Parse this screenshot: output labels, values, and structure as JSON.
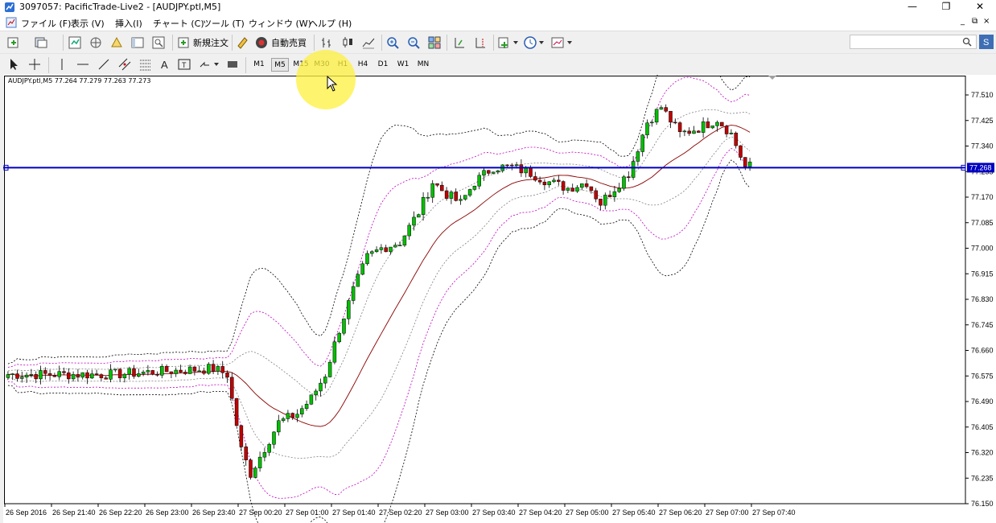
{
  "window": {
    "title": "3097057: PacificTrade-Live2 - [AUDJPY.ptl,M5]",
    "minimize_glyph": "—",
    "restore_glyph": "❐",
    "close_glyph": "✕"
  },
  "menu": {
    "items": [
      "ファイル (F)",
      "表示 (V)",
      "挿入(I)",
      "チャート (C)",
      "ツール (T)",
      "ウィンドウ (W)",
      "ヘルプ (H)"
    ],
    "mdi_glyphs": [
      "_",
      "⧉",
      "×"
    ]
  },
  "toolbar": {
    "new_order_label": "新規注文",
    "auto_trade_label": "自動売買"
  },
  "timeframes": {
    "items": [
      "M1",
      "M5",
      "M15",
      "M30",
      "H1",
      "H4",
      "D1",
      "W1",
      "MN"
    ],
    "active": "M5"
  },
  "chart": {
    "info_label": "AUDJPY.ptl,M5  77.264 77.279 77.263 77.273",
    "current_price_label": "77.268",
    "colors": {
      "bull": "#00c000",
      "bear": "#c00000",
      "price_line": "#0000c0",
      "band_outer": "#000000",
      "band_mid": "#c000c0",
      "ma": "#8b0000"
    }
  },
  "chart_data": {
    "type": "candlestick",
    "symbol": "AUDJPY.ptl",
    "timeframe": "M5",
    "ylim": [
      76.15,
      77.51
    ],
    "y_ticks": [
      "77.510",
      "77.425",
      "77.340",
      "77.255",
      "77.170",
      "77.085",
      "77.000",
      "76.915",
      "76.830",
      "76.745",
      "76.660",
      "76.575",
      "76.490",
      "76.405",
      "76.320",
      "76.235",
      "76.150"
    ],
    "x_ticks": [
      "26 Sep 2016",
      "26 Sep 21:40",
      "26 Sep 22:20",
      "26 Sep 23:00",
      "26 Sep 23:40",
      "27 Sep 00:20",
      "27 Sep 01:00",
      "27 Sep 01:40",
      "27 Sep 02:20",
      "27 Sep 03:00",
      "27 Sep 03:40",
      "27 Sep 04:20",
      "27 Sep 05:00",
      "27 Sep 05:40",
      "27 Sep 06:20",
      "27 Sep 07:00",
      "27 Sep 07:40"
    ],
    "current_price": 77.268,
    "ohlc": [
      77.264,
      77.279,
      77.263,
      77.273
    ]
  }
}
